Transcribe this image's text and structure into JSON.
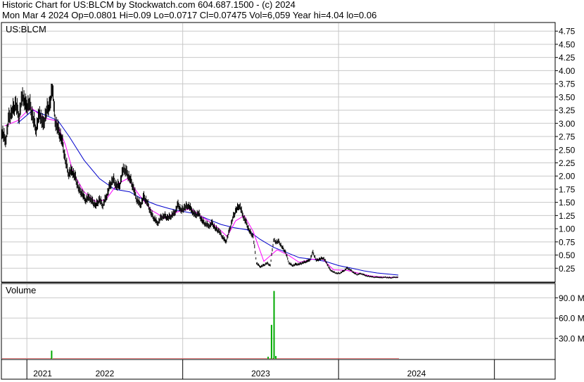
{
  "header": {
    "line1": "Historic Chart for US:BLCM by Stockwatch.com 604.687.1500 - (c) 2024",
    "line2": "Mon Mar  4 2024  Op=0.0801  Hi=0.09  Lo=0.0717  Cl=0.07475  Vol=6,059  Year hi=4.04  lo=0.06"
  },
  "chart_data": [
    {
      "type": "line",
      "title": "US:BLCM",
      "ylim": [
        0,
        4.9
      ],
      "y_ticks": [
        "0.25",
        "0.50",
        "0.75",
        "1.00",
        "1.25",
        "1.50",
        "1.75",
        "2.00",
        "2.25",
        "2.50",
        "2.75",
        "3.00",
        "3.25",
        "3.50",
        "3.75",
        "4.00",
        "4.25",
        "4.50",
        "4.75"
      ],
      "y_tick_values": [
        0.25,
        0.5,
        0.75,
        1.0,
        1.25,
        1.5,
        1.75,
        2.0,
        2.25,
        2.5,
        2.75,
        3.0,
        3.25,
        3.5,
        3.75,
        4.0,
        4.25,
        4.5,
        4.75
      ],
      "x_range": [
        "2020-11-04",
        "2024-03-04"
      ],
      "year_labels": [
        "2021",
        "2022",
        "2023",
        "2024"
      ],
      "year_boundaries": [
        "2021-01-01",
        "2022-01-01",
        "2023-01-01",
        "2024-01-01"
      ],
      "grid": true,
      "colors": {
        "price": "#000000",
        "ma_short": "#ff00ff",
        "ma_long": "#0000cc",
        "grid": "#c8c8c8"
      },
      "price_points": [
        [
          "2020-11-04",
          2.85
        ],
        [
          "2020-11-12",
          2.65
        ],
        [
          "2020-11-20",
          3.1
        ],
        [
          "2020-11-28",
          3.25
        ],
        [
          "2020-12-06",
          3.35
        ],
        [
          "2020-12-14",
          3.15
        ],
        [
          "2020-12-22",
          3.55
        ],
        [
          "2020-12-30",
          3.3
        ],
        [
          "2021-01-07",
          3.4
        ],
        [
          "2021-01-15",
          3.1
        ],
        [
          "2021-01-23",
          2.9
        ],
        [
          "2021-01-31",
          3.2
        ],
        [
          "2021-02-08",
          2.95
        ],
        [
          "2021-02-16",
          3.25
        ],
        [
          "2021-02-24",
          3.35
        ],
        [
          "2021-03-02",
          3.7
        ],
        [
          "2021-03-08",
          3.05
        ],
        [
          "2021-03-16",
          2.85
        ],
        [
          "2021-03-24",
          2.7
        ],
        [
          "2021-04-01",
          2.3
        ],
        [
          "2021-04-09",
          2.05
        ],
        [
          "2021-04-17",
          2.1
        ],
        [
          "2021-04-25",
          1.95
        ],
        [
          "2021-05-03",
          1.75
        ],
        [
          "2021-05-11",
          1.65
        ],
        [
          "2021-05-19",
          1.55
        ],
        [
          "2021-05-27",
          1.6
        ],
        [
          "2021-06-04",
          1.5
        ],
        [
          "2021-06-12",
          1.45
        ],
        [
          "2021-06-20",
          1.55
        ],
        [
          "2021-06-28",
          1.45
        ],
        [
          "2021-07-06",
          1.6
        ],
        [
          "2021-07-14",
          1.8
        ],
        [
          "2021-07-22",
          1.95
        ],
        [
          "2021-07-30",
          1.8
        ],
        [
          "2021-08-07",
          1.85
        ],
        [
          "2021-08-15",
          2.15
        ],
        [
          "2021-08-23",
          2.05
        ],
        [
          "2021-08-31",
          1.95
        ],
        [
          "2021-09-08",
          1.75
        ],
        [
          "2021-09-16",
          1.55
        ],
        [
          "2021-09-24",
          1.45
        ],
        [
          "2021-10-02",
          1.6
        ],
        [
          "2021-10-10",
          1.5
        ],
        [
          "2021-10-18",
          1.3
        ],
        [
          "2021-10-26",
          1.2
        ],
        [
          "2021-11-03",
          1.1
        ],
        [
          "2021-11-11",
          1.2
        ],
        [
          "2021-11-19",
          1.25
        ],
        [
          "2021-11-27",
          1.2
        ],
        [
          "2021-12-05",
          1.25
        ],
        [
          "2021-12-13",
          1.3
        ],
        [
          "2021-12-21",
          1.45
        ],
        [
          "2021-12-29",
          1.35
        ],
        [
          "2022-01-06",
          1.4
        ],
        [
          "2022-01-14",
          1.45
        ],
        [
          "2022-01-22",
          1.35
        ],
        [
          "2022-01-30",
          1.25
        ],
        [
          "2022-02-07",
          1.3
        ],
        [
          "2022-02-15",
          1.15
        ],
        [
          "2022-02-23",
          1.1
        ],
        [
          "2022-03-03",
          1.05
        ],
        [
          "2022-03-11",
          1.1
        ],
        [
          "2022-03-19",
          1.0
        ],
        [
          "2022-03-27",
          0.95
        ],
        [
          "2022-04-04",
          0.85
        ],
        [
          "2022-04-12",
          0.75
        ],
        [
          "2022-04-20",
          0.95
        ],
        [
          "2022-04-28",
          1.2
        ],
        [
          "2022-05-06",
          1.35
        ],
        [
          "2022-05-14",
          1.45
        ],
        [
          "2022-05-22",
          1.25
        ],
        [
          "2022-05-30",
          1.1
        ],
        [
          "2022-06-07",
          0.95
        ],
        [
          "2022-06-15",
          0.85
        ],
        [
          "2022-06-23",
          0.35
        ],
        [
          "2022-07-01",
          0.28
        ],
        [
          "2022-07-09",
          0.3
        ],
        [
          "2022-07-17",
          0.35
        ],
        [
          "2022-07-25",
          0.3
        ],
        [
          "2022-08-02",
          0.8
        ],
        [
          "2022-08-06",
          0.75
        ],
        [
          "2022-08-14",
          0.75
        ],
        [
          "2022-08-22",
          0.65
        ],
        [
          "2022-08-30",
          0.55
        ],
        [
          "2022-09-07",
          0.35
        ],
        [
          "2022-09-15",
          0.3
        ],
        [
          "2022-09-23",
          0.32
        ],
        [
          "2022-10-01",
          0.33
        ],
        [
          "2022-10-09",
          0.35
        ],
        [
          "2022-10-17",
          0.38
        ],
        [
          "2022-10-25",
          0.4
        ],
        [
          "2022-11-02",
          0.55
        ],
        [
          "2022-11-10",
          0.4
        ],
        [
          "2022-11-18",
          0.42
        ],
        [
          "2022-11-26",
          0.45
        ],
        [
          "2022-12-04",
          0.35
        ],
        [
          "2022-12-12",
          0.22
        ],
        [
          "2022-12-20",
          0.18
        ],
        [
          "2022-12-28",
          0.15
        ],
        [
          "2023-01-05",
          0.16
        ],
        [
          "2023-01-13",
          0.2
        ],
        [
          "2023-01-21",
          0.25
        ],
        [
          "2023-01-29",
          0.22
        ],
        [
          "2023-02-06",
          0.16
        ],
        [
          "2023-02-14",
          0.13
        ],
        [
          "2023-02-22",
          0.15
        ],
        [
          "2023-03-02",
          0.12
        ],
        [
          "2023-03-10",
          0.1
        ],
        [
          "2023-03-18",
          0.09
        ],
        [
          "2023-03-26",
          0.08
        ],
        [
          "2023-04-03",
          0.08
        ],
        [
          "2023-04-11",
          0.07
        ],
        [
          "2023-04-19",
          0.08
        ],
        [
          "2023-04-27",
          0.07
        ],
        [
          "2023-05-05",
          0.07
        ],
        [
          "2023-05-13",
          0.08
        ],
        [
          "2023-05-21",
          0.075
        ]
      ],
      "ma_short_points": [
        [
          "2020-11-10",
          2.95
        ],
        [
          "2020-12-10",
          3.05
        ],
        [
          "2021-01-10",
          3.3
        ],
        [
          "2021-02-10",
          3.1
        ],
        [
          "2021-03-10",
          3.05
        ],
        [
          "2021-04-01",
          2.6
        ],
        [
          "2021-04-20",
          2.05
        ],
        [
          "2021-05-15",
          1.7
        ],
        [
          "2021-06-10",
          1.52
        ],
        [
          "2021-07-05",
          1.55
        ],
        [
          "2021-08-01",
          1.85
        ],
        [
          "2021-08-25",
          1.95
        ],
        [
          "2021-09-20",
          1.65
        ],
        [
          "2021-10-20",
          1.35
        ],
        [
          "2021-11-20",
          1.2
        ],
        [
          "2021-12-20",
          1.32
        ],
        [
          "2022-01-20",
          1.38
        ],
        [
          "2022-02-20",
          1.2
        ],
        [
          "2022-03-20",
          1.05
        ],
        [
          "2022-04-15",
          0.85
        ],
        [
          "2022-05-05",
          1.15
        ],
        [
          "2022-05-25",
          1.25
        ],
        [
          "2022-06-15",
          0.95
        ],
        [
          "2022-07-10",
          0.38
        ],
        [
          "2022-08-10",
          0.6
        ],
        [
          "2022-09-05",
          0.5
        ],
        [
          "2022-10-01",
          0.36
        ],
        [
          "2022-11-01",
          0.42
        ],
        [
          "2022-11-25",
          0.42
        ],
        [
          "2022-12-20",
          0.22
        ],
        [
          "2023-01-20",
          0.21
        ],
        [
          "2023-02-20",
          0.15
        ],
        [
          "2023-03-20",
          0.1
        ],
        [
          "2023-04-20",
          0.08
        ],
        [
          "2023-05-21",
          0.075
        ]
      ],
      "ma_long_points": [
        [
          "2020-12-10",
          3.0
        ],
        [
          "2021-01-15",
          3.25
        ],
        [
          "2021-02-15",
          3.15
        ],
        [
          "2021-03-15",
          3.05
        ],
        [
          "2021-04-10",
          2.75
        ],
        [
          "2021-05-15",
          2.3
        ],
        [
          "2021-06-20",
          1.95
        ],
        [
          "2021-07-25",
          1.75
        ],
        [
          "2021-08-30",
          1.7
        ],
        [
          "2021-10-01",
          1.55
        ],
        [
          "2021-11-01",
          1.45
        ],
        [
          "2021-12-01",
          1.38
        ],
        [
          "2022-01-01",
          1.33
        ],
        [
          "2022-02-01",
          1.28
        ],
        [
          "2022-03-01",
          1.18
        ],
        [
          "2022-04-01",
          1.08
        ],
        [
          "2022-05-01",
          1.02
        ],
        [
          "2022-06-01",
          0.98
        ],
        [
          "2022-07-01",
          0.8
        ],
        [
          "2022-08-01",
          0.65
        ],
        [
          "2022-09-01",
          0.55
        ],
        [
          "2022-10-01",
          0.45
        ],
        [
          "2022-11-01",
          0.42
        ],
        [
          "2022-12-01",
          0.38
        ],
        [
          "2023-01-01",
          0.3
        ],
        [
          "2023-02-01",
          0.25
        ],
        [
          "2023-03-01",
          0.2
        ],
        [
          "2023-04-01",
          0.16
        ],
        [
          "2023-05-21",
          0.12
        ]
      ]
    },
    {
      "type": "bar",
      "title": "Volume",
      "ylim": [
        0,
        110
      ],
      "y_ticks": [
        "30.0 M",
        "60.0 M",
        "90.0 M"
      ],
      "y_tick_values": [
        30,
        60,
        90
      ],
      "units": "M",
      "spikes": [
        [
          "2021-02-28",
          12
        ],
        [
          "2022-07-28",
          50
        ],
        [
          "2022-08-03",
          100
        ],
        [
          "2022-08-07",
          4
        ],
        [
          "2022-07-20",
          3
        ]
      ],
      "baseline": 1
    }
  ]
}
